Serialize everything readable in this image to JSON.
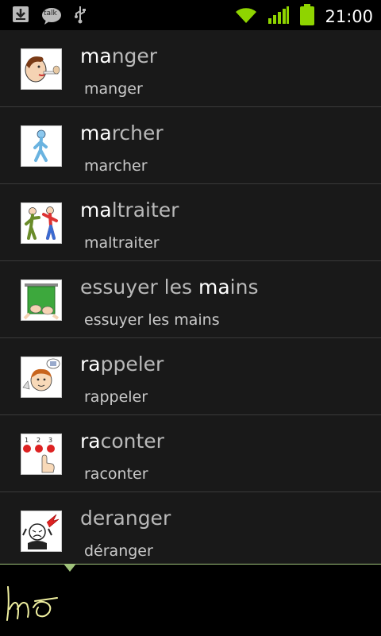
{
  "status_bar": {
    "time": "21:00",
    "talk_label": "talk",
    "icons": [
      "download-icon",
      "talk-icon",
      "usb-icon",
      "wifi-icon",
      "signal-icon",
      "battery-icon"
    ],
    "accent": "#8fd400"
  },
  "list": {
    "items": [
      {
        "highlight": "ma",
        "rest": "nger",
        "pre": "",
        "subtitle": "manger",
        "picto": "eating-picto"
      },
      {
        "highlight": "ma",
        "rest": "rcher",
        "pre": "",
        "subtitle": "marcher",
        "picto": "walking-picto"
      },
      {
        "highlight": "ma",
        "rest": "ltraiter",
        "pre": "",
        "subtitle": "maltraiter",
        "picto": "mistreat-picto"
      },
      {
        "pre": "essuyer les ",
        "highlight": "ma",
        "rest": "ins",
        "subtitle": "essuyer les mains",
        "picto": "towel-picto"
      },
      {
        "highlight": "ra",
        "rest": "ppeler",
        "pre": "",
        "subtitle": "rappeler",
        "picto": "remember-picto"
      },
      {
        "highlight": "ra",
        "rest": "conter",
        "pre": "",
        "subtitle": "raconter",
        "picto": "tell-picto"
      },
      {
        "pre": "",
        "highlight": "",
        "rest": "deranger",
        "subtitle": "déranger",
        "picto": "disturb-picto"
      }
    ]
  },
  "handwriting": {
    "ink_color": "#f0f0a0",
    "line_color": "#9fc27a"
  }
}
